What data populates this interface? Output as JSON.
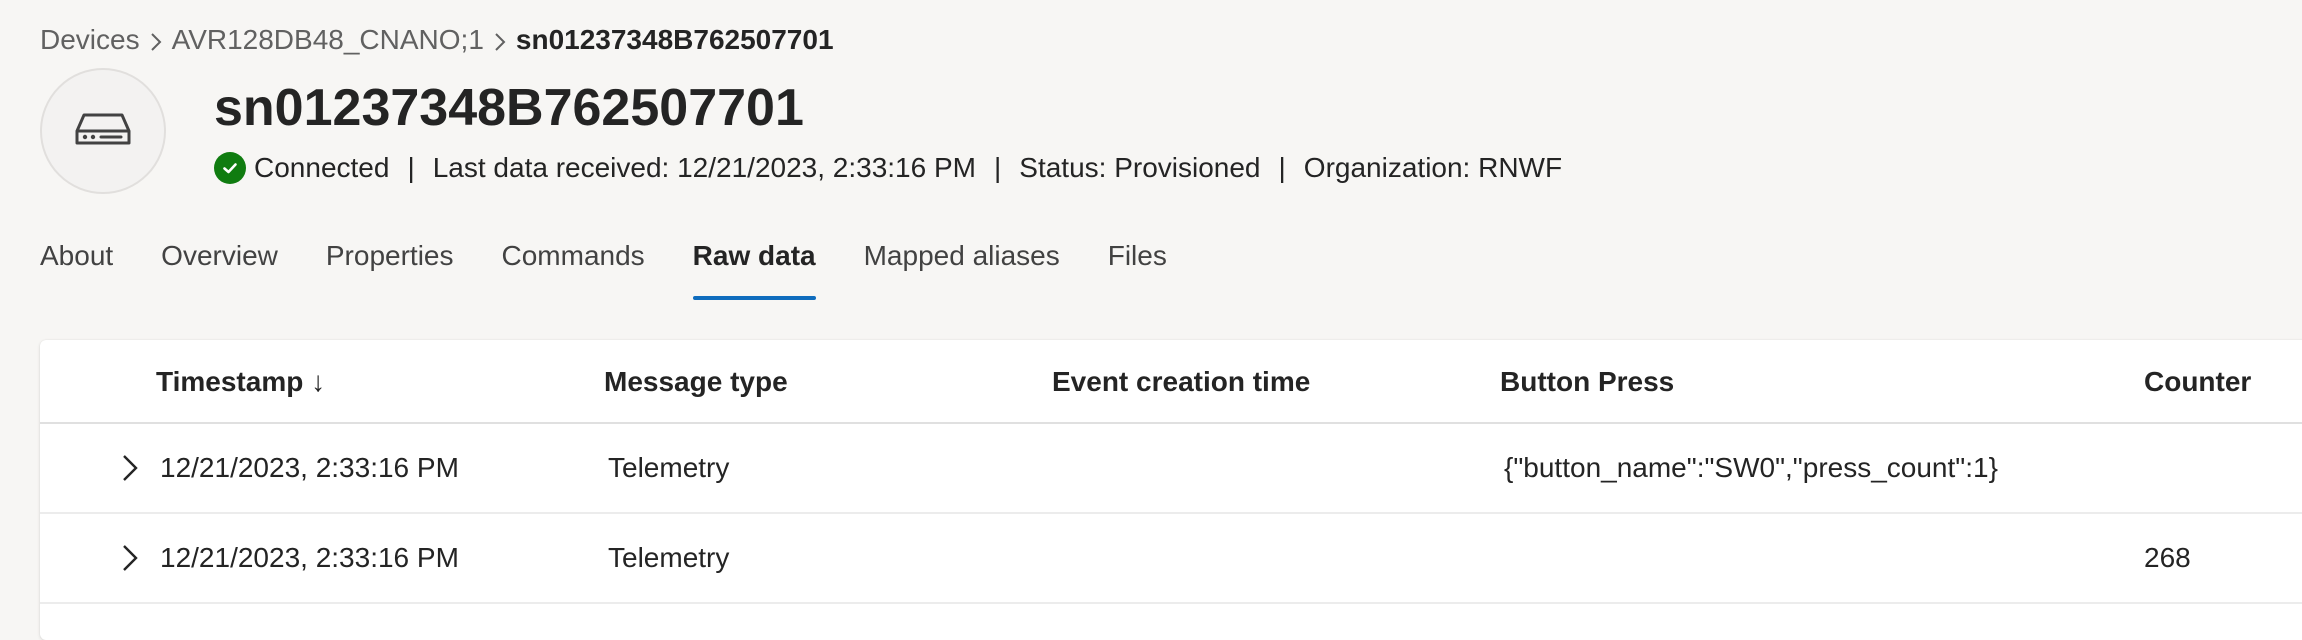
{
  "breadcrumb": {
    "items": [
      "Devices",
      "AVR128DB48_CNANO;1"
    ],
    "current": "sn01237348B762507701"
  },
  "header": {
    "title": "sn01237348B762507701",
    "connection": "Connected",
    "last_data": "Last data received: 12/21/2023, 2:33:16 PM",
    "status": "Status: Provisioned",
    "organization": "Organization: RNWF",
    "separator": "|"
  },
  "tabs": [
    {
      "label": "About"
    },
    {
      "label": "Overview"
    },
    {
      "label": "Properties"
    },
    {
      "label": "Commands"
    },
    {
      "label": "Raw data",
      "active": true
    },
    {
      "label": "Mapped aliases"
    },
    {
      "label": "Files"
    }
  ],
  "table": {
    "columns": {
      "timestamp": "Timestamp ↓",
      "message_type": "Message type",
      "event_creation_time": "Event creation time",
      "button_press": "Button Press",
      "counter": "Counter"
    },
    "rows": [
      {
        "timestamp": "12/21/2023, 2:33:16 PM",
        "message_type": "Telemetry",
        "event_creation_time": "",
        "button_press": "{\"button_name\":\"SW0\",\"press_count\":1}",
        "counter": ""
      },
      {
        "timestamp": "12/21/2023, 2:33:16 PM",
        "message_type": "Telemetry",
        "event_creation_time": "",
        "button_press": "",
        "counter": "268"
      }
    ]
  },
  "colors": {
    "accent": "#0f6cbd",
    "connected": "#107c10",
    "background": "#f7f6f4"
  },
  "icons": {
    "breadcrumb_separator": "chevron-right-icon",
    "device": "device-drive-icon",
    "connected": "checkmark-circle-icon",
    "row_expander": "chevron-right-icon"
  }
}
